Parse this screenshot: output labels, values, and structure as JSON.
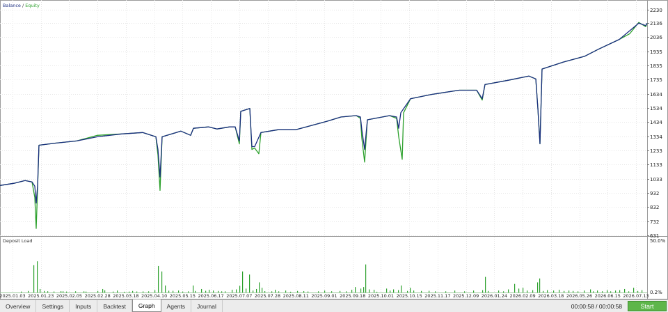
{
  "chart_data": [
    {
      "type": "line",
      "legend": {
        "balance_label": "Balance",
        "separator": " / ",
        "equity_label": "Equity"
      },
      "colors": {
        "balance": "#1a2d80",
        "equity": "#2ca02c"
      },
      "y_ticks": [
        "2230",
        "2136",
        "2036",
        "1935",
        "1835",
        "1735",
        "1634",
        "1534",
        "1434",
        "1334",
        "1233",
        "1133",
        "1033",
        "932",
        "832",
        "732",
        "631"
      ],
      "ylim": [
        631,
        2230
      ],
      "x_ticks": [
        "2025.01.03",
        "2025.01.23",
        "2025.02.05",
        "2025.02.28",
        "2025.03.18",
        "2025.04.10",
        "2025.05.15",
        "2025.06.17",
        "2025.07.07",
        "2025.07.28",
        "2025.08.11",
        "2025.09.01",
        "2025.09.18",
        "2025.10.01",
        "2025.10.15",
        "2025.11.17",
        "2025.12.09",
        "2026.01.24",
        "2026.02.09",
        "2026.03.18",
        "2026.05.26",
        "2026.06.15",
        "2026.07.13"
      ],
      "balance": [
        [
          0,
          985
        ],
        [
          20,
          1000
        ],
        [
          36,
          1020
        ],
        [
          46,
          1010
        ],
        [
          50,
          980
        ],
        [
          52,
          860
        ],
        [
          54,
          980
        ],
        [
          56,
          1270
        ],
        [
          80,
          1285
        ],
        [
          110,
          1300
        ],
        [
          140,
          1330
        ],
        [
          175,
          1350
        ],
        [
          205,
          1360
        ],
        [
          224,
          1330
        ],
        [
          227,
          1240
        ],
        [
          230,
          1045
        ],
        [
          233,
          1330
        ],
        [
          260,
          1370
        ],
        [
          274,
          1340
        ],
        [
          278,
          1390
        ],
        [
          300,
          1400
        ],
        [
          312,
          1385
        ],
        [
          330,
          1400
        ],
        [
          338,
          1400
        ],
        [
          344,
          1300
        ],
        [
          346,
          1510
        ],
        [
          359,
          1530
        ],
        [
          362,
          1260
        ],
        [
          366,
          1260
        ],
        [
          375,
          1360
        ],
        [
          400,
          1380
        ],
        [
          425,
          1380
        ],
        [
          440,
          1400
        ],
        [
          470,
          1440
        ],
        [
          490,
          1470
        ],
        [
          512,
          1480
        ],
        [
          518,
          1470
        ],
        [
          520,
          1380
        ],
        [
          524,
          1240
        ],
        [
          528,
          1450
        ],
        [
          560,
          1480
        ],
        [
          570,
          1470
        ],
        [
          573,
          1390
        ],
        [
          576,
          1500
        ],
        [
          590,
          1600
        ],
        [
          620,
          1630
        ],
        [
          660,
          1660
        ],
        [
          685,
          1660
        ],
        [
          693,
          1600
        ],
        [
          697,
          1700
        ],
        [
          730,
          1730
        ],
        [
          760,
          1760
        ],
        [
          770,
          1740
        ],
        [
          773,
          1530
        ],
        [
          776,
          1280
        ],
        [
          779,
          1810
        ],
        [
          810,
          1860
        ],
        [
          840,
          1900
        ],
        [
          860,
          1950
        ],
        [
          890,
          2020
        ],
        [
          918,
          2135
        ],
        [
          928,
          2118
        ],
        [
          930,
          2135
        ]
      ],
      "equity": [
        [
          0,
          985
        ],
        [
          20,
          1000
        ],
        [
          36,
          1020
        ],
        [
          46,
          1010
        ],
        [
          50,
          900
        ],
        [
          52,
          680
        ],
        [
          54,
          960
        ],
        [
          56,
          1270
        ],
        [
          80,
          1285
        ],
        [
          110,
          1300
        ],
        [
          140,
          1340
        ],
        [
          175,
          1350
        ],
        [
          205,
          1360
        ],
        [
          224,
          1330
        ],
        [
          227,
          1200
        ],
        [
          230,
          950
        ],
        [
          233,
          1330
        ],
        [
          260,
          1370
        ],
        [
          274,
          1340
        ],
        [
          278,
          1390
        ],
        [
          300,
          1400
        ],
        [
          312,
          1385
        ],
        [
          330,
          1400
        ],
        [
          338,
          1400
        ],
        [
          344,
          1280
        ],
        [
          346,
          1510
        ],
        [
          359,
          1530
        ],
        [
          362,
          1240
        ],
        [
          366,
          1250
        ],
        [
          372,
          1210
        ],
        [
          375,
          1360
        ],
        [
          400,
          1380
        ],
        [
          425,
          1380
        ],
        [
          440,
          1400
        ],
        [
          470,
          1440
        ],
        [
          490,
          1470
        ],
        [
          512,
          1480
        ],
        [
          518,
          1460
        ],
        [
          520,
          1320
        ],
        [
          524,
          1150
        ],
        [
          528,
          1450
        ],
        [
          560,
          1480
        ],
        [
          570,
          1460
        ],
        [
          573,
          1330
        ],
        [
          578,
          1170
        ],
        [
          580,
          1500
        ],
        [
          590,
          1600
        ],
        [
          620,
          1630
        ],
        [
          660,
          1660
        ],
        [
          685,
          1660
        ],
        [
          693,
          1590
        ],
        [
          697,
          1700
        ],
        [
          730,
          1730
        ],
        [
          760,
          1760
        ],
        [
          770,
          1740
        ],
        [
          773,
          1530
        ],
        [
          776,
          1280
        ],
        [
          779,
          1810
        ],
        [
          810,
          1860
        ],
        [
          840,
          1900
        ],
        [
          860,
          1950
        ],
        [
          890,
          2020
        ],
        [
          905,
          2060
        ],
        [
          918,
          2140
        ],
        [
          928,
          2110
        ],
        [
          930,
          2135
        ]
      ]
    },
    {
      "type": "bar",
      "title": "Deposit Load",
      "color": "#2ca02c",
      "y_ticks": [
        "50.0%",
        "0.2%"
      ],
      "ylim": [
        0,
        50
      ],
      "bars": [
        [
          30,
          1.2
        ],
        [
          40,
          2.0
        ],
        [
          48,
          35
        ],
        [
          53,
          40
        ],
        [
          57,
          4.5
        ],
        [
          63,
          2.0
        ],
        [
          68,
          1.6
        ],
        [
          77,
          1.3
        ],
        [
          87,
          1.7
        ],
        [
          90,
          1.6
        ],
        [
          95,
          1.2
        ],
        [
          108,
          1.5
        ],
        [
          120,
          1.5
        ],
        [
          123,
          1.2
        ],
        [
          140,
          2.0
        ],
        [
          147,
          4.5
        ],
        [
          150,
          2.8
        ],
        [
          162,
          1.2
        ],
        [
          168,
          2.5
        ],
        [
          178,
          1.0
        ],
        [
          185,
          1.2
        ],
        [
          190,
          2.0
        ],
        [
          196,
          1.3
        ],
        [
          205,
          1.4
        ],
        [
          213,
          1.5
        ],
        [
          222,
          3.0
        ],
        [
          227,
          34
        ],
        [
          232,
          27
        ],
        [
          237,
          9.0
        ],
        [
          242,
          2.3
        ],
        [
          248,
          2.2
        ],
        [
          256,
          2.5
        ],
        [
          262,
          1.2
        ],
        [
          270,
          1.5
        ],
        [
          277,
          9.0
        ],
        [
          280,
          2.0
        ],
        [
          289,
          4.5
        ],
        [
          295,
          2.2
        ],
        [
          300,
          3.5
        ],
        [
          306,
          2.5
        ],
        [
          313,
          2.0
        ],
        [
          318,
          1.5
        ],
        [
          323,
          1.5
        ],
        [
          333,
          3.5
        ],
        [
          339,
          4.0
        ],
        [
          344,
          8.5
        ],
        [
          348,
          27
        ],
        [
          353,
          5.0
        ],
        [
          358,
          23
        ],
        [
          363,
          2.5
        ],
        [
          368,
          4.5
        ],
        [
          372,
          13
        ],
        [
          376,
          6.0
        ],
        [
          380,
          1.8
        ],
        [
          390,
          1.5
        ],
        [
          395,
          3.5
        ],
        [
          400,
          1.5
        ],
        [
          410,
          2.5
        ],
        [
          417,
          1.0
        ],
        [
          427,
          2.0
        ],
        [
          436,
          1.8
        ],
        [
          442,
          1.3
        ],
        [
          457,
          1.5
        ],
        [
          466,
          2.5
        ],
        [
          476,
          1.6
        ],
        [
          488,
          2.0
        ],
        [
          497,
          1.5
        ],
        [
          505,
          3.5
        ],
        [
          510,
          7.0
        ],
        [
          518,
          5.0
        ],
        [
          522,
          7.0
        ],
        [
          525,
          36
        ],
        [
          530,
          4.0
        ],
        [
          537,
          3.5
        ],
        [
          541,
          1.0
        ],
        [
          555,
          5.0
        ],
        [
          560,
          2.5
        ],
        [
          565,
          4.0
        ],
        [
          572,
          3.0
        ],
        [
          576,
          9.0
        ],
        [
          585,
          2.0
        ],
        [
          589,
          6.0
        ],
        [
          594,
          2.5
        ],
        [
          605,
          2.0
        ],
        [
          616,
          2.2
        ],
        [
          625,
          1.5
        ],
        [
          640,
          1.5
        ],
        [
          653,
          2.5
        ],
        [
          667,
          1.5
        ],
        [
          680,
          2.5
        ],
        [
          693,
          3.0
        ],
        [
          697,
          20
        ],
        [
          701,
          2.0
        ],
        [
          716,
          2.5
        ],
        [
          723,
          1.5
        ],
        [
          730,
          4.0
        ],
        [
          739,
          11
        ],
        [
          745,
          5.0
        ],
        [
          751,
          6.0
        ],
        [
          757,
          2.5
        ],
        [
          765,
          3.0
        ],
        [
          772,
          13
        ],
        [
          775,
          18
        ],
        [
          780,
          2.0
        ],
        [
          786,
          3.0
        ],
        [
          795,
          2.5
        ],
        [
          803,
          3.5
        ],
        [
          810,
          2.0
        ],
        [
          817,
          2.5
        ],
        [
          823,
          2.0
        ],
        [
          830,
          1.5
        ],
        [
          839,
          2.5
        ],
        [
          848,
          4.0
        ],
        [
          852,
          1.5
        ],
        [
          858,
          2.5
        ],
        [
          865,
          1.6
        ],
        [
          872,
          3.0
        ],
        [
          877,
          1.5
        ],
        [
          884,
          2.5
        ],
        [
          890,
          3.0
        ],
        [
          897,
          4.5
        ],
        [
          903,
          1.5
        ],
        [
          910,
          6.0
        ],
        [
          916,
          2.0
        ],
        [
          922,
          3.0
        ]
      ]
    }
  ],
  "tabs": [
    {
      "label": "Overview",
      "active": false
    },
    {
      "label": "Settings",
      "active": false
    },
    {
      "label": "Inputs",
      "active": false
    },
    {
      "label": "Backtest",
      "active": false
    },
    {
      "label": "Graph",
      "active": true
    },
    {
      "label": "Agents",
      "active": false
    },
    {
      "label": "Journal",
      "active": false
    }
  ],
  "timer": "00:00:58 / 00:00:58",
  "start_button": "Start"
}
